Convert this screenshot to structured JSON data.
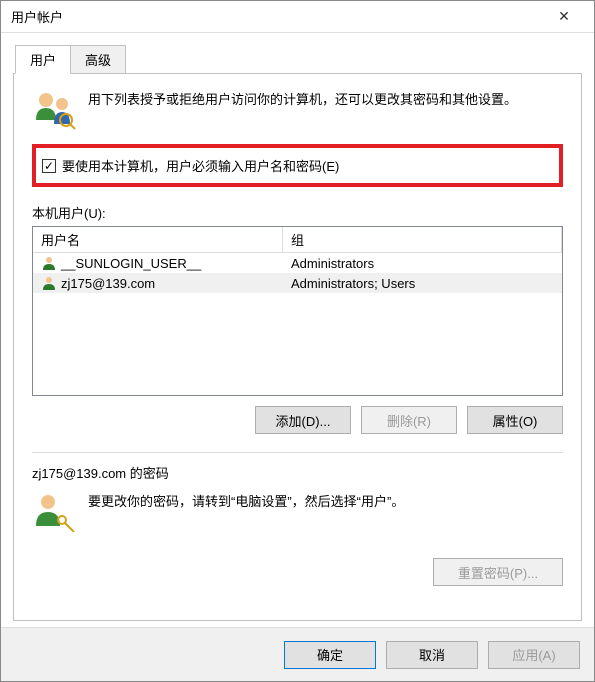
{
  "window": {
    "title": "用户帐户"
  },
  "tabs": {
    "users": "用户",
    "advanced": "高级"
  },
  "intro": "用下列表授予或拒绝用户访问你的计算机，还可以更改其密码和其他设置。",
  "checkbox": {
    "label": "要使用本计算机，用户必须输入用户名和密码(E)",
    "checked": "✓"
  },
  "userlist": {
    "label": "本机用户(U):",
    "headers": {
      "name": "用户名",
      "group": "组"
    },
    "rows": [
      {
        "name": "__SUNLOGIN_USER__",
        "group": "Administrators"
      },
      {
        "name": "zj175@139.com",
        "group": "Administrators; Users"
      }
    ]
  },
  "buttons": {
    "add": "添加(D)...",
    "remove": "删除(R)",
    "props": "属性(O)"
  },
  "password": {
    "heading": "zj175@139.com 的密码",
    "text": "要更改你的密码，请转到“电脑设置”，然后选择“用户”。",
    "reset": "重置密码(P)..."
  },
  "footer": {
    "ok": "确定",
    "cancel": "取消",
    "apply": "应用(A)"
  }
}
